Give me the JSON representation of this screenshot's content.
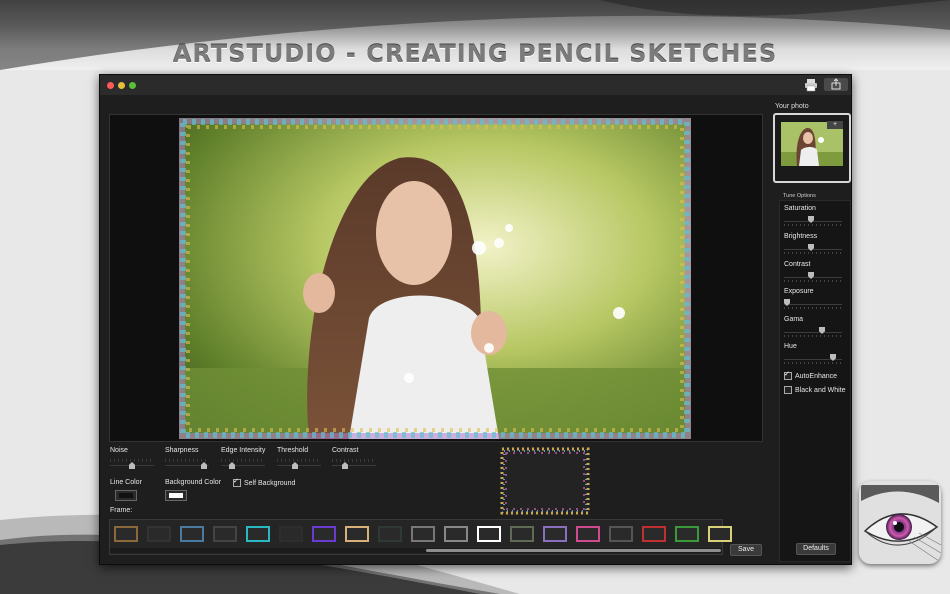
{
  "banner": {
    "title": "ARTSTUDIO - CREATING PENCIL SKETCHES"
  },
  "window": {
    "toolbar": {
      "print_icon": "printer-icon",
      "share_icon": "share-icon"
    }
  },
  "sidebar": {
    "your_photo_label": "Your photo",
    "thumb_add_label": "+",
    "tune_options_label": "Tune Options",
    "sliders": [
      {
        "label": "Saturation",
        "value": 0.45
      },
      {
        "label": "Brightness",
        "value": 0.45
      },
      {
        "label": "Contrast",
        "value": 0.45
      },
      {
        "label": "Exposure",
        "value": 0.0
      },
      {
        "label": "Gama",
        "value": 0.65
      },
      {
        "label": "Hue",
        "value": 0.85
      }
    ],
    "checkboxes": [
      {
        "label": "AutoEnhance",
        "checked": true
      },
      {
        "label": "Black and White",
        "checked": false
      }
    ],
    "defaults_label": "Defaults"
  },
  "controls": {
    "noise_label": "Noise",
    "sharpness_label": "Sharpness",
    "edge_intensity_label": "Edge Intensity",
    "threshold_label": "Threshold",
    "contrast_label": "Contrast",
    "noise_value": 0.5,
    "sharpness_value": 0.95,
    "edge_value": 0.2,
    "threshold_value": 0.4,
    "contrast_value": 0.25,
    "line_color_label": "Line Color",
    "line_color": "#111111",
    "background_color_label": "Background Color",
    "background_color": "#ffffff",
    "self_background_label": "Self Background",
    "self_background_checked": true,
    "frame_label": "Frame:",
    "save_label": "Save"
  },
  "frames": {
    "colors": [
      "#8a6a3a",
      "#333333",
      "#4a7aa0",
      "#444444",
      "#29b7c2",
      "#2e2e2e",
      "#6a3bd0",
      "#d6b27a",
      "#2f3a34",
      "#777777",
      "#888888",
      "#ffffff",
      "#606b55",
      "#8a6ec0",
      "#d04a90",
      "#555555",
      "#c03030",
      "#3a9a3a",
      "#d7d27a"
    ]
  }
}
